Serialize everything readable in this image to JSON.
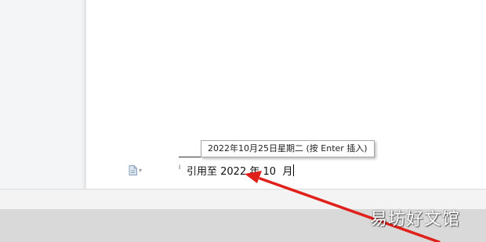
{
  "document": {
    "footnote_mark": "i",
    "typed_prefix": "引用至 ",
    "typed_year": "2022",
    "typed_year_unit": " 年",
    "typed_month": " 10",
    "typed_month_unit": "  月"
  },
  "autocomplete": {
    "suggestion": "2022年10月25日星期二 (按 Enter 插入)"
  },
  "icons": {
    "paste_options": "document-icon",
    "annotation": "red-arrow"
  },
  "colors": {
    "arrow": "#e0201a",
    "tooltip_border": "#a7a7a7"
  },
  "watermark": {
    "text": "易坊好文馆"
  }
}
